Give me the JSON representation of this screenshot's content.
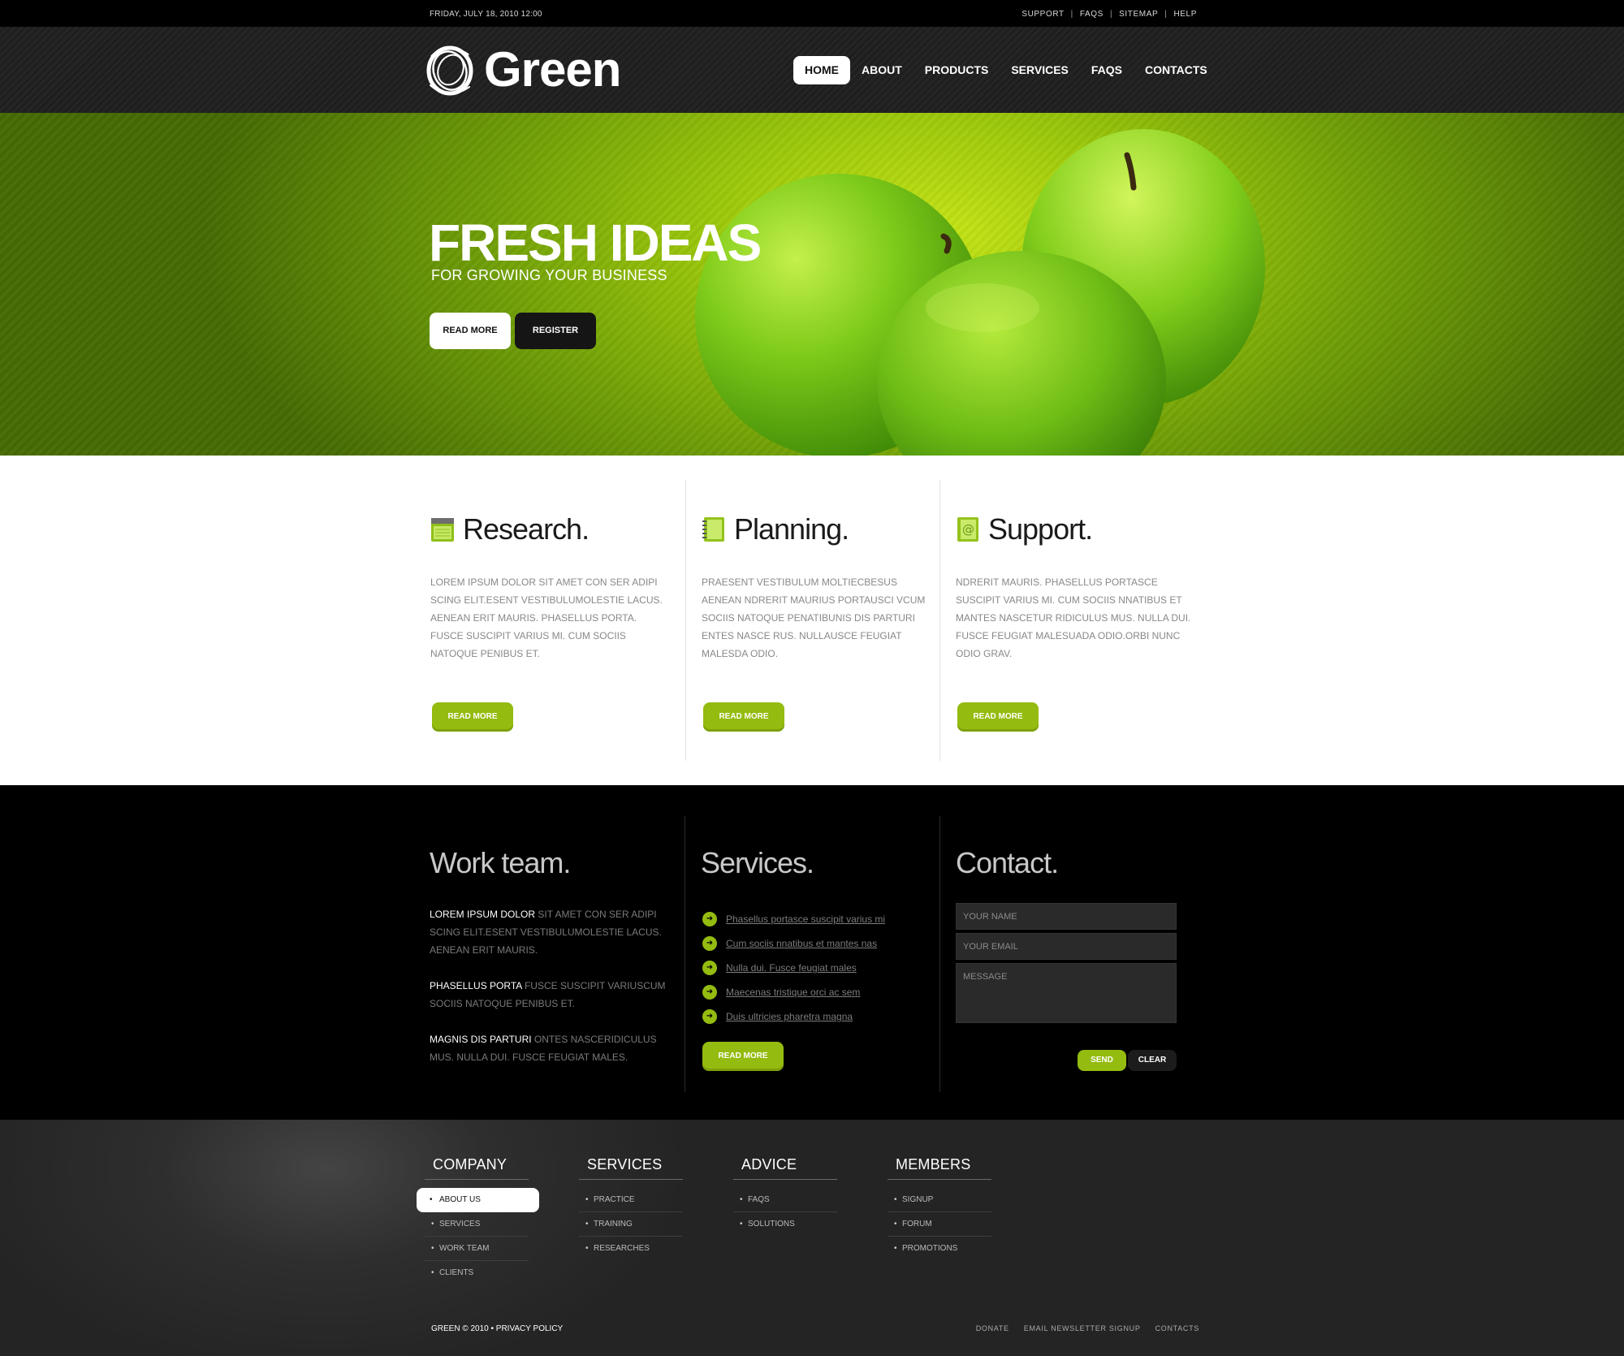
{
  "topbar": {
    "date": "FRIDAY, JULY 18, 2010 12:00",
    "links": [
      "SUPPORT",
      "FAQS",
      "SITEMAP",
      "HELP"
    ]
  },
  "header": {
    "logo_text": "Green",
    "nav": [
      {
        "label": "HOME",
        "active": true
      },
      {
        "label": "ABOUT"
      },
      {
        "label": "PRODUCTS"
      },
      {
        "label": "SERVICES"
      },
      {
        "label": "FAQS"
      },
      {
        "label": "CONTACTS"
      }
    ]
  },
  "hero": {
    "title": "FRESH IDEAS",
    "subtitle": "FOR GROWING YOUR BUSINESS",
    "read_more": "READ MORE",
    "register": "REGISTER"
  },
  "features": [
    {
      "title": "Research.",
      "icon": "notepad-icon",
      "text": "LOREM IPSUM DOLOR SIT AMET CON SER ADIPI SCING ELIT.ESENT VESTIBULUMOLESTIE LACUS. AENEAN ERIT MAURIS. PHASELLUS PORTA. FUSCE SUSCIPIT VARIUS MI. CUM SOCIIS NATOQUE PENIBUS ET.",
      "button": "READ MORE"
    },
    {
      "title": "Planning.",
      "icon": "notebook-icon",
      "text": "PRAESENT VESTIBULUM MOLTIECBESUS AENEAN NDRERIT MAURIUS PORTAUSCI VCUM SOCIIS NATOQUE PENATIBUNIS DIS PARTURI ENTES NASCE RUS. NULLAUSCE FEUGIAT MALESDA ODIO.",
      "button": "READ MORE"
    },
    {
      "title": "Support.",
      "icon": "address-book-icon",
      "text": "NDRERIT MAURIS. PHASELLUS PORTASCE SUSCIPIT VARIUS MI. CUM SOCIIS NNATIBUS ET MANTES NASCETUR RIDICULUS MUS. NULLA DUI. FUSCE FEUGIAT MALESUADA ODIO.ORBI NUNC ODIO GRAV.",
      "button": "READ MORE"
    }
  ],
  "team": {
    "title": "Work team.",
    "paragraphs": [
      {
        "bold": "LOREM IPSUM DOLOR",
        "rest": " SIT AMET CON SER ADIPI SCING ELIT.ESENT VESTIBULUMOLESTIE LACUS. AENEAN ERIT MAURIS."
      },
      {
        "bold": "PHASELLUS PORTA",
        "rest": " FUSCE SUSCIPIT VARIUSCUM SOCIIS NATOQUE PENIBUS ET."
      },
      {
        "bold": "MAGNIS DIS PARTURI",
        "rest": " ONTES NASCERIDICULUS MUS. NULLA DUI. FUSCE FEUGIAT MALES."
      }
    ]
  },
  "services": {
    "title": "Services.",
    "items": [
      "Phasellus portasce suscipit varius mi",
      "Cum sociis nnatibus et mantes nas",
      "Nulla dui. Fusce feugiat males",
      "Maecenas tristique orci ac sem",
      "Duis ultricies pharetra magna"
    ],
    "button": "READ MORE"
  },
  "contact": {
    "title": "Contact.",
    "name_placeholder": "YOUR NAME",
    "email_placeholder": "YOUR EMAIL",
    "message_placeholder": "MESSAGE",
    "send": "SEND",
    "clear": "CLEAR"
  },
  "footer": {
    "columns": [
      {
        "title": "COMPANY",
        "items": [
          "ABOUT US",
          "SERVICES",
          "WORK  TEAM",
          "CLIENTS"
        ],
        "active": 0
      },
      {
        "title": "SERVICES",
        "items": [
          "PRACTICE",
          "TRAINING",
          "RESEARCHES"
        ]
      },
      {
        "title": "ADVICE",
        "items": [
          "FAQS",
          "SOLUTIONS"
        ]
      },
      {
        "title": "MEMBERS",
        "items": [
          "SIGNUP",
          "FORUM",
          "PROMOTIONS"
        ]
      }
    ],
    "copyright": "GREEN © 2010 • PRIVACY POLICY",
    "links": [
      "DONATE",
      "EMAIL NEWSLETTER SIGNUP",
      "CONTACTS"
    ]
  },
  "colors": {
    "accent": "#94bb0f",
    "hero_green": "#9cc80a",
    "dark": "#000000"
  }
}
